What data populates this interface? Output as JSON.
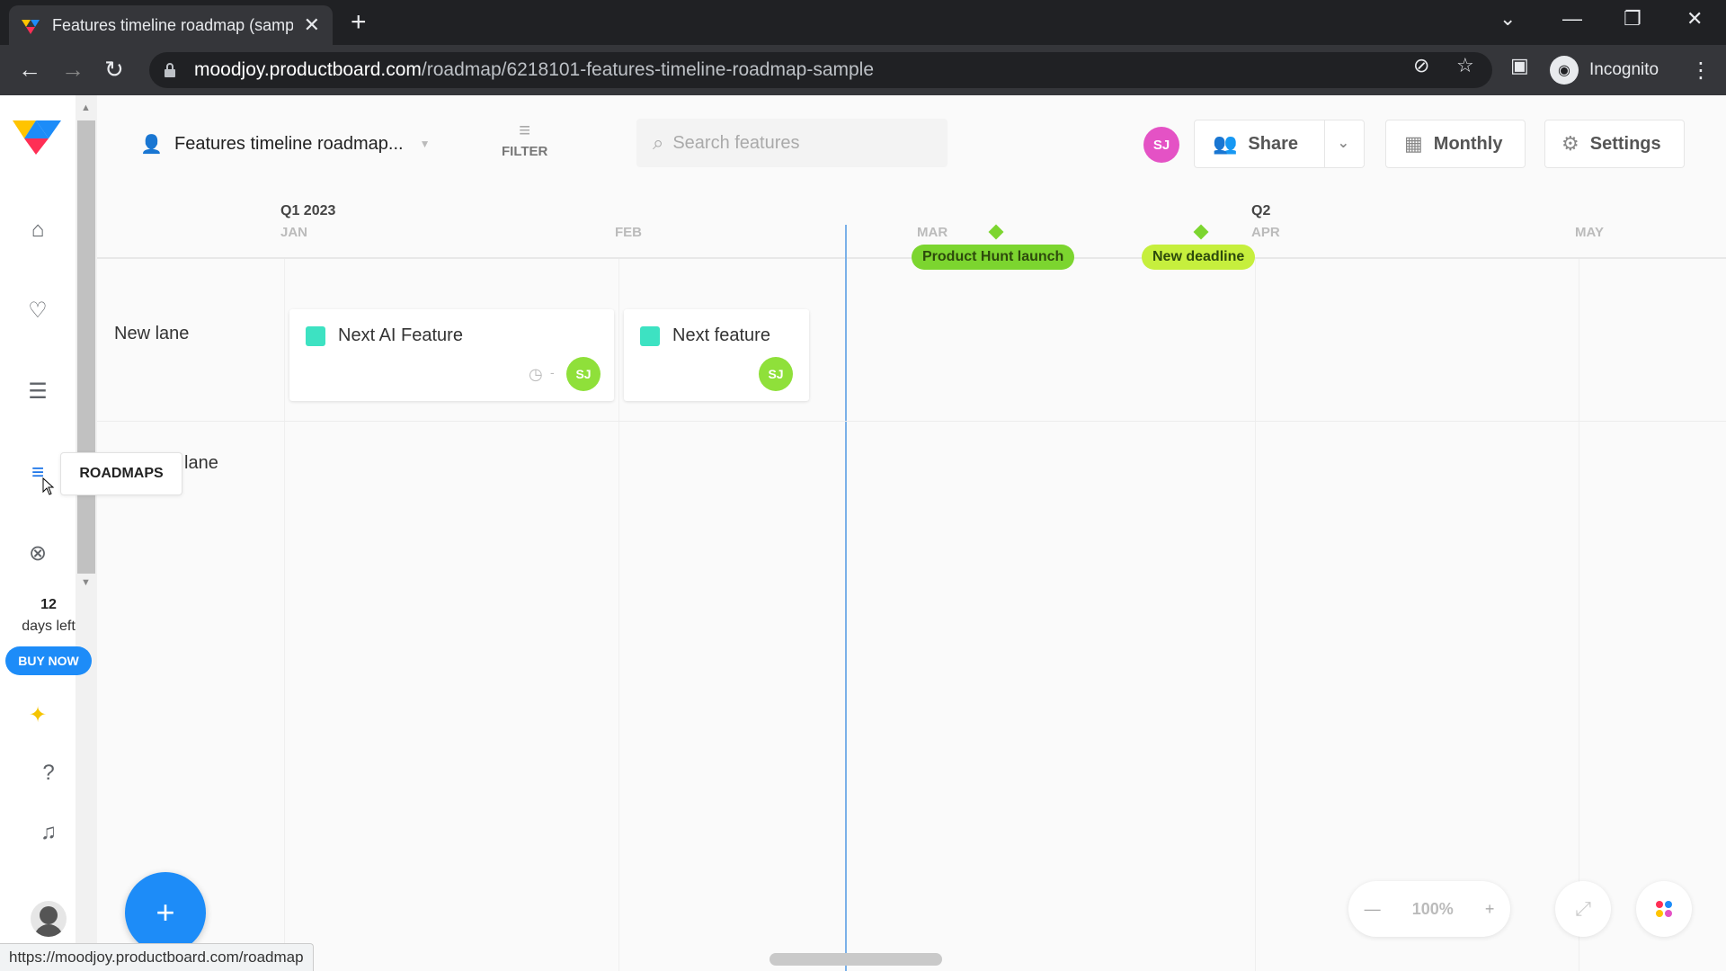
{
  "browser": {
    "tab_title": "Features timeline roadmap (samp",
    "url_host": "moodjoy.productboard.com",
    "url_path": "/roadmap/6218101-features-timeline-roadmap-sample",
    "profile_label": "Incognito",
    "status_url": "https://moodjoy.productboard.com/roadmap"
  },
  "sidebar": {
    "trial_days": "12",
    "trial_label": "days left",
    "buy_label": "BUY NOW",
    "tooltip": "ROADMAPS"
  },
  "toolbar": {
    "roadmap_title": "Features timeline roadmap...",
    "filter_label": "FILTER",
    "search_placeholder": "Search features",
    "avatar_initials": "SJ",
    "share_label": "Share",
    "view_label": "Monthly",
    "settings_label": "Settings"
  },
  "timeline": {
    "quarters": [
      "Q1 2023",
      "Q2"
    ],
    "months": [
      "JAN",
      "FEB",
      "MAR",
      "APR",
      "MAY"
    ],
    "milestones": [
      {
        "label": "Product Hunt launch",
        "color": "#7cd52f"
      },
      {
        "label": "New deadline",
        "color": "#c6ef3d"
      }
    ],
    "lanes": [
      "New lane",
      "lane"
    ],
    "cards": [
      {
        "name": "Next AI Feature",
        "due": "-",
        "owner": "SJ"
      },
      {
        "name": "Next feature",
        "owner": "SJ"
      }
    ]
  },
  "zoom": {
    "value": "100%"
  },
  "colors": {
    "accent": "#1d8cf8",
    "feature_chip": "#3de2c2",
    "owner_avatar": "#8fe03a",
    "user_avatar": "#e452c5"
  }
}
